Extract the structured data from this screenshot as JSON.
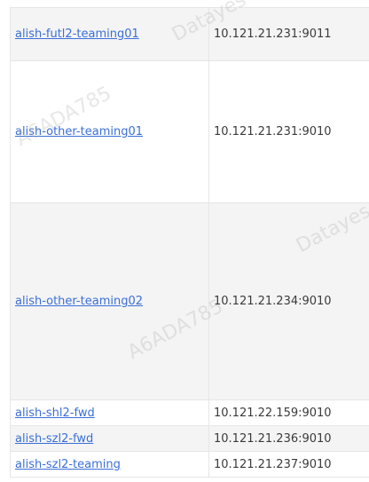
{
  "table": {
    "rows": [
      {
        "name": "alish-futl2-teaming01",
        "address": "10.121.21.231:9011"
      },
      {
        "name": "alish-other-teaming01",
        "address": "10.121.21.231:9010"
      },
      {
        "name": "alish-other-teaming02",
        "address": "10.121.21.234:9010"
      },
      {
        "name": "alish-shl2-fwd",
        "address": "10.121.22.159:9010"
      },
      {
        "name": "alish-szl2-fwd",
        "address": "10.121.21.236:9010"
      },
      {
        "name": "alish-szl2-teaming",
        "address": "10.121.21.237:9010"
      }
    ]
  },
  "watermarks": {
    "brand": "Datayes",
    "code": "A6ADA785"
  },
  "colors": {
    "link": "#3a6fd8",
    "row_shade": "#f4f4f4",
    "border": "#e6e6e6"
  }
}
